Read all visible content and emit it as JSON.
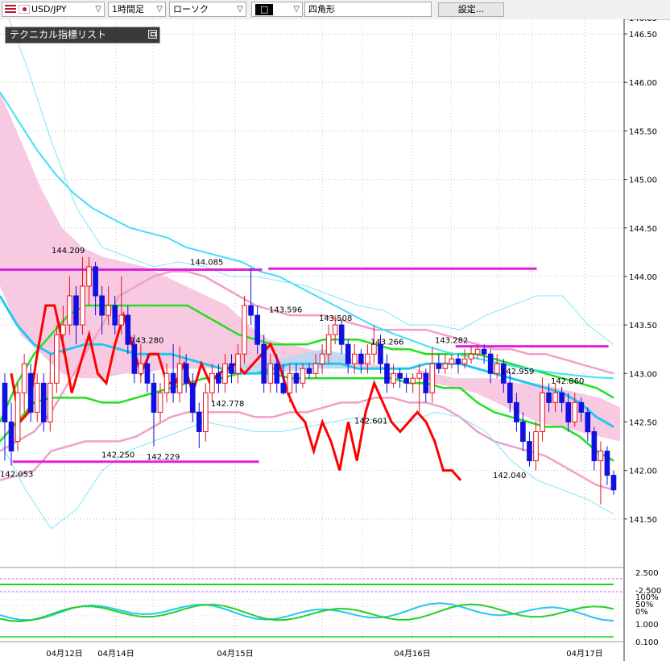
{
  "toolbar": {
    "pair": "USD/JPY",
    "timeframe": "1時間足",
    "chart_style": "ローソク",
    "drawing_mode": "□",
    "shape": "四角形",
    "settings_label": "設定..."
  },
  "panel": {
    "title": "テクニカル指標リスト"
  },
  "colors": {
    "bull": "#e8101a",
    "bear": "#1010e0",
    "ichimoku_line": "#ff0000",
    "kumo_pink": "#f4b8d8",
    "kumo_blue": "#b8d8f4",
    "bb_inner": "#20e020",
    "bb_outer": "#f0a0c8",
    "ma_short": "#20c8f0",
    "ma_long": "#40e0f8",
    "hline": "#e020e0"
  },
  "chart_data": {
    "type": "candlestick",
    "symbol": "USD/JPY",
    "timeframe": "1時間足",
    "y_ticks": [
      "146.50",
      "146.00",
      "145.50",
      "145.00",
      "144.50",
      "144.00",
      "143.50",
      "143.00",
      "142.50",
      "142.00",
      "141.50"
    ],
    "y_top_partial": "146.85",
    "ylim": [
      141.0,
      146.6
    ],
    "x_ticks": [
      "04月12日",
      "04月14日",
      "04月15日",
      "04月16日",
      "04月17日"
    ],
    "price_annotations": [
      {
        "label": "144.209",
        "value": 144.209
      },
      {
        "label": "144.085",
        "value": 144.085
      },
      {
        "label": "143.596",
        "value": 143.596
      },
      {
        "label": "143.508",
        "value": 143.508
      },
      {
        "label": "143.280",
        "value": 143.28
      },
      {
        "label": "143.266",
        "value": 143.266
      },
      {
        "label": "143.282",
        "value": 143.282
      },
      {
        "label": "142.959",
        "value": 142.959
      },
      {
        "label": "142.860",
        "value": 142.86
      },
      {
        "label": "142.778",
        "value": 142.778
      },
      {
        "label": "142.601",
        "value": 142.601
      },
      {
        "label": "142.250",
        "value": 142.25
      },
      {
        "label": "142.229",
        "value": 142.229
      },
      {
        "label": "142.053",
        "value": 142.053
      },
      {
        "label": "142.040",
        "value": 142.04
      }
    ],
    "horizontal_lines": [
      {
        "value": 144.07,
        "x_from": 0.0,
        "x_to": 0.42
      },
      {
        "value": 144.08,
        "x_from": 0.43,
        "x_to": 0.86
      },
      {
        "value": 143.28,
        "x_from": 0.73,
        "x_to": 0.975
      },
      {
        "value": 142.09,
        "x_from": 0.02,
        "x_to": 0.415
      }
    ],
    "sub_panels": [
      {
        "labels": [
          "2.500",
          "-2.500"
        ]
      },
      {
        "labels": [
          "100%",
          "50%",
          "0%"
        ]
      },
      {
        "labels": [
          "1.000",
          "0.100"
        ]
      }
    ],
    "candles": [
      [
        142.9,
        142.5,
        143.0,
        142.1
      ],
      [
        142.5,
        142.2,
        142.7,
        142.05
      ],
      [
        142.3,
        142.8,
        142.9,
        142.2
      ],
      [
        142.8,
        143.1,
        143.2,
        142.6
      ],
      [
        143.0,
        142.6,
        143.1,
        142.5
      ],
      [
        142.6,
        142.9,
        143.0,
        142.5
      ],
      [
        142.9,
        142.5,
        143.0,
        142.4
      ],
      [
        142.5,
        142.9,
        143.2,
        142.4
      ],
      [
        142.9,
        143.4,
        143.5,
        142.8
      ],
      [
        143.4,
        143.5,
        143.7,
        143.2
      ],
      [
        143.5,
        143.8,
        144.0,
        143.4
      ],
      [
        143.8,
        143.5,
        143.9,
        143.3
      ],
      [
        143.5,
        143.9,
        144.2,
        143.4
      ],
      [
        143.9,
        144.1,
        144.2,
        143.7
      ],
      [
        144.1,
        143.8,
        144.15,
        143.6
      ],
      [
        143.8,
        143.6,
        143.9,
        143.4
      ],
      [
        143.6,
        143.7,
        143.9,
        143.5
      ],
      [
        143.7,
        143.5,
        143.8,
        143.4
      ],
      [
        143.5,
        143.6,
        144.0,
        143.4
      ],
      [
        143.6,
        143.3,
        143.7,
        143.2
      ],
      [
        143.3,
        143.0,
        143.4,
        142.9
      ],
      [
        143.0,
        143.1,
        143.3,
        142.9
      ],
      [
        143.1,
        142.9,
        143.2,
        142.8
      ],
      [
        142.9,
        142.6,
        143.0,
        142.25
      ],
      [
        142.6,
        142.8,
        142.9,
        142.5
      ],
      [
        142.8,
        143.0,
        143.1,
        142.7
      ],
      [
        143.0,
        142.8,
        143.3,
        142.7
      ],
      [
        142.8,
        143.1,
        143.28,
        142.7
      ],
      [
        143.1,
        142.9,
        143.2,
        142.8
      ],
      [
        142.9,
        142.6,
        143.0,
        142.5
      ],
      [
        142.6,
        142.4,
        142.7,
        142.23
      ],
      [
        142.4,
        142.8,
        142.9,
        142.3
      ],
      [
        142.8,
        143.0,
        143.1,
        142.7
      ],
      [
        143.0,
        142.9,
        143.1,
        142.8
      ],
      [
        142.9,
        143.1,
        143.2,
        142.8
      ],
      [
        143.1,
        143.0,
        143.2,
        142.9
      ],
      [
        143.0,
        143.2,
        143.3,
        142.9
      ],
      [
        143.2,
        143.7,
        143.8,
        143.1
      ],
      [
        143.7,
        143.6,
        144.085,
        143.5
      ],
      [
        143.6,
        143.3,
        143.7,
        143.2
      ],
      [
        143.3,
        142.9,
        143.4,
        142.8
      ],
      [
        142.9,
        143.1,
        143.2,
        142.8
      ],
      [
        143.1,
        142.9,
        143.2,
        142.8
      ],
      [
        142.9,
        142.8,
        143.1,
        142.78
      ],
      [
        142.8,
        143.0,
        143.1,
        142.7
      ],
      [
        143.0,
        142.9,
        143.1,
        142.8
      ],
      [
        142.9,
        143.05,
        143.1,
        142.85
      ],
      [
        143.05,
        143.0,
        143.1,
        142.95
      ],
      [
        143.0,
        143.1,
        143.2,
        142.95
      ],
      [
        143.1,
        143.2,
        143.3,
        143.0
      ],
      [
        143.2,
        143.4,
        143.5,
        143.1
      ],
      [
        143.4,
        143.5,
        143.6,
        143.3
      ],
      [
        143.5,
        143.3,
        143.55,
        143.2
      ],
      [
        143.3,
        143.1,
        143.35,
        143.0
      ],
      [
        143.1,
        143.2,
        143.3,
        143.0
      ],
      [
        143.2,
        143.1,
        143.25,
        143.0
      ],
      [
        143.1,
        143.2,
        143.3,
        143.0
      ],
      [
        143.2,
        143.3,
        143.5,
        143.1
      ],
      [
        143.3,
        143.1,
        143.4,
        143.0
      ],
      [
        143.1,
        142.9,
        143.2,
        142.8
      ],
      [
        142.9,
        143.0,
        143.1,
        142.85
      ],
      [
        143.0,
        142.95,
        143.05,
        142.85
      ],
      [
        142.95,
        142.9,
        143.0,
        142.8
      ],
      [
        142.9,
        142.95,
        143.0,
        142.8
      ],
      [
        142.95,
        143.0,
        143.1,
        142.6
      ],
      [
        143.0,
        142.8,
        143.05,
        142.7
      ],
      [
        142.8,
        143.1,
        143.27,
        142.7
      ],
      [
        143.1,
        143.05,
        143.2,
        143.0
      ],
      [
        143.05,
        143.1,
        143.2,
        143.0
      ],
      [
        143.1,
        143.15,
        143.2,
        143.05
      ],
      [
        143.15,
        143.1,
        143.2,
        143.0
      ],
      [
        143.1,
        143.15,
        143.25,
        143.05
      ],
      [
        143.15,
        143.2,
        143.28,
        143.1
      ],
      [
        143.2,
        143.25,
        143.3,
        143.15
      ],
      [
        143.25,
        143.2,
        143.3,
        143.1
      ],
      [
        143.2,
        143.0,
        143.25,
        142.9
      ],
      [
        143.0,
        143.1,
        143.2,
        142.95
      ],
      [
        143.1,
        142.9,
        143.15,
        142.8
      ],
      [
        142.9,
        142.7,
        143.0,
        142.6
      ],
      [
        142.7,
        142.5,
        142.8,
        142.4
      ],
      [
        142.5,
        142.3,
        142.6,
        142.2
      ],
      [
        142.3,
        142.1,
        142.4,
        142.04
      ],
      [
        142.1,
        142.4,
        142.5,
        142.0
      ],
      [
        142.4,
        142.8,
        142.96,
        142.3
      ],
      [
        142.8,
        142.7,
        142.9,
        142.6
      ],
      [
        142.7,
        142.8,
        142.9,
        142.6
      ],
      [
        142.8,
        142.7,
        142.86,
        142.6
      ],
      [
        142.7,
        142.5,
        142.8,
        142.4
      ],
      [
        142.5,
        142.7,
        142.8,
        142.45
      ],
      [
        142.7,
        142.6,
        142.75,
        142.5
      ],
      [
        142.6,
        142.4,
        142.65,
        142.3
      ],
      [
        142.4,
        142.1,
        142.45,
        142.0
      ],
      [
        142.1,
        142.2,
        142.3,
        141.65
      ],
      [
        142.2,
        141.95,
        142.25,
        141.85
      ],
      [
        141.95,
        141.8,
        142.0,
        141.75
      ]
    ],
    "ichimoku_lagging": [
      143.0,
      142.5,
      142.6,
      143.2,
      143.7,
      143.7,
      143.3,
      142.8,
      143.1,
      143.4,
      143.0,
      142.9,
      143.3,
      143.6,
      143.3,
      143.0,
      143.2,
      143.2,
      142.9,
      142.9,
      143.1,
      142.8,
      143.1,
      142.9,
      143.0,
      143.05,
      143.1,
      143.0,
      143.1,
      143.2,
      143.3,
      143.1,
      142.8,
      142.6,
      142.5,
      142.2,
      142.5,
      142.3,
      142.0,
      142.5,
      142.1,
      142.6,
      142.9,
      142.7,
      142.5,
      142.4,
      142.5,
      142.6,
      142.5,
      142.3,
      142.0,
      142.0,
      141.9
    ],
    "bb_upper2": [
      142.2,
      142.3,
      142.4,
      142.6,
      142.9,
      143.2,
      143.5,
      143.8,
      143.9,
      144.0,
      144.05,
      144.05,
      144.0,
      143.9,
      143.8,
      143.7,
      143.65,
      143.6,
      143.6,
      143.6,
      143.55,
      143.5,
      143.45,
      143.45,
      143.45,
      143.45,
      143.4,
      143.35,
      143.3,
      143.25,
      143.25,
      143.2,
      143.2,
      143.15,
      143.1,
      143.05,
      143.0
    ],
    "bb_upper1": [
      142.5,
      142.9,
      143.2,
      143.4,
      143.6,
      143.7,
      143.7,
      143.7,
      143.7,
      143.7,
      143.7,
      143.7,
      143.6,
      143.5,
      143.4,
      143.35,
      143.3,
      143.3,
      143.3,
      143.35,
      143.35,
      143.35,
      143.3,
      143.25,
      143.25,
      143.2,
      143.2,
      143.2,
      143.2,
      143.15,
      143.1,
      143.05,
      143.0,
      142.95,
      142.9,
      142.85,
      142.75
    ],
    "bb_lower1": [
      142.3,
      142.5,
      142.7,
      142.75,
      142.75,
      142.75,
      142.7,
      142.7,
      142.75,
      142.8,
      142.85,
      142.9,
      142.95,
      142.95,
      143.0,
      143.0,
      143.0,
      142.95,
      142.95,
      142.95,
      142.95,
      142.95,
      142.95,
      142.95,
      142.9,
      142.9,
      142.85,
      142.85,
      142.7,
      142.6,
      142.55,
      142.5,
      142.45,
      142.45,
      142.35,
      142.2,
      142.1
    ],
    "bb_lower2": [
      141.9,
      141.95,
      142.0,
      142.2,
      142.25,
      142.3,
      142.3,
      142.3,
      142.35,
      142.45,
      142.55,
      142.6,
      142.6,
      142.6,
      142.6,
      142.55,
      142.55,
      142.6,
      142.6,
      142.65,
      142.7,
      142.7,
      142.75,
      142.75,
      142.7,
      142.7,
      142.65,
      142.55,
      142.4,
      142.3,
      142.25,
      142.2,
      142.15,
      142.05,
      141.95,
      141.85,
      141.8
    ],
    "ma_short": [
      143.8,
      143.5,
      143.3,
      143.2,
      143.25,
      143.3,
      143.3,
      143.25,
      143.2,
      143.2,
      143.2,
      143.15,
      143.1,
      143.05,
      143.0,
      143.0,
      143.05,
      143.1,
      143.1,
      143.1,
      143.1,
      143.05,
      143.05,
      143.05,
      143.05,
      143.1,
      143.1,
      143.1,
      143.05,
      143.0,
      142.95,
      142.9,
      142.85,
      142.8,
      142.7,
      142.55,
      142.45
    ],
    "ma_long": [
      145.9,
      145.6,
      145.3,
      145.05,
      144.85,
      144.7,
      144.6,
      144.5,
      144.45,
      144.4,
      144.3,
      144.25,
      144.2,
      144.15,
      144.05,
      144.0,
      143.9,
      143.8,
      143.7,
      143.6,
      143.5,
      143.42,
      143.35,
      143.28,
      143.22,
      143.18,
      143.14,
      143.1,
      143.06,
      143.03,
      143.0,
      142.98,
      142.96,
      142.95
    ]
  }
}
